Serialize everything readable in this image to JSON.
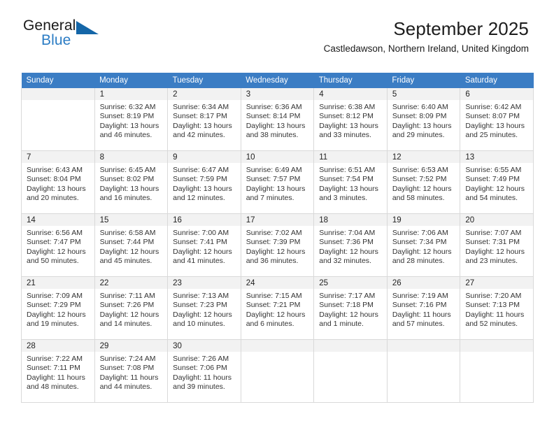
{
  "brand": {
    "name_part1": "General",
    "name_part2": "Blue",
    "triangle_color": "#1466a8",
    "blue_color": "#2b7cc4"
  },
  "header": {
    "title": "September 2025",
    "location": "Castledawson, Northern Ireland, United Kingdom"
  },
  "calendar": {
    "header_bg": "#3b7dc4",
    "daynum_bg": "#f2f2f2",
    "weekday_headers": [
      "Sunday",
      "Monday",
      "Tuesday",
      "Wednesday",
      "Thursday",
      "Friday",
      "Saturday"
    ],
    "weeks": [
      [
        {
          "day": "",
          "sunrise": "",
          "sunset": "",
          "daylight1": "",
          "daylight2": "",
          "empty": true
        },
        {
          "day": "1",
          "sunrise": "Sunrise: 6:32 AM",
          "sunset": "Sunset: 8:19 PM",
          "daylight1": "Daylight: 13 hours",
          "daylight2": "and 46 minutes."
        },
        {
          "day": "2",
          "sunrise": "Sunrise: 6:34 AM",
          "sunset": "Sunset: 8:17 PM",
          "daylight1": "Daylight: 13 hours",
          "daylight2": "and 42 minutes."
        },
        {
          "day": "3",
          "sunrise": "Sunrise: 6:36 AM",
          "sunset": "Sunset: 8:14 PM",
          "daylight1": "Daylight: 13 hours",
          "daylight2": "and 38 minutes."
        },
        {
          "day": "4",
          "sunrise": "Sunrise: 6:38 AM",
          "sunset": "Sunset: 8:12 PM",
          "daylight1": "Daylight: 13 hours",
          "daylight2": "and 33 minutes."
        },
        {
          "day": "5",
          "sunrise": "Sunrise: 6:40 AM",
          "sunset": "Sunset: 8:09 PM",
          "daylight1": "Daylight: 13 hours",
          "daylight2": "and 29 minutes."
        },
        {
          "day": "6",
          "sunrise": "Sunrise: 6:42 AM",
          "sunset": "Sunset: 8:07 PM",
          "daylight1": "Daylight: 13 hours",
          "daylight2": "and 25 minutes."
        }
      ],
      [
        {
          "day": "7",
          "sunrise": "Sunrise: 6:43 AM",
          "sunset": "Sunset: 8:04 PM",
          "daylight1": "Daylight: 13 hours",
          "daylight2": "and 20 minutes."
        },
        {
          "day": "8",
          "sunrise": "Sunrise: 6:45 AM",
          "sunset": "Sunset: 8:02 PM",
          "daylight1": "Daylight: 13 hours",
          "daylight2": "and 16 minutes."
        },
        {
          "day": "9",
          "sunrise": "Sunrise: 6:47 AM",
          "sunset": "Sunset: 7:59 PM",
          "daylight1": "Daylight: 13 hours",
          "daylight2": "and 12 minutes."
        },
        {
          "day": "10",
          "sunrise": "Sunrise: 6:49 AM",
          "sunset": "Sunset: 7:57 PM",
          "daylight1": "Daylight: 13 hours",
          "daylight2": "and 7 minutes."
        },
        {
          "day": "11",
          "sunrise": "Sunrise: 6:51 AM",
          "sunset": "Sunset: 7:54 PM",
          "daylight1": "Daylight: 13 hours",
          "daylight2": "and 3 minutes."
        },
        {
          "day": "12",
          "sunrise": "Sunrise: 6:53 AM",
          "sunset": "Sunset: 7:52 PM",
          "daylight1": "Daylight: 12 hours",
          "daylight2": "and 58 minutes."
        },
        {
          "day": "13",
          "sunrise": "Sunrise: 6:55 AM",
          "sunset": "Sunset: 7:49 PM",
          "daylight1": "Daylight: 12 hours",
          "daylight2": "and 54 minutes."
        }
      ],
      [
        {
          "day": "14",
          "sunrise": "Sunrise: 6:56 AM",
          "sunset": "Sunset: 7:47 PM",
          "daylight1": "Daylight: 12 hours",
          "daylight2": "and 50 minutes."
        },
        {
          "day": "15",
          "sunrise": "Sunrise: 6:58 AM",
          "sunset": "Sunset: 7:44 PM",
          "daylight1": "Daylight: 12 hours",
          "daylight2": "and 45 minutes."
        },
        {
          "day": "16",
          "sunrise": "Sunrise: 7:00 AM",
          "sunset": "Sunset: 7:41 PM",
          "daylight1": "Daylight: 12 hours",
          "daylight2": "and 41 minutes."
        },
        {
          "day": "17",
          "sunrise": "Sunrise: 7:02 AM",
          "sunset": "Sunset: 7:39 PM",
          "daylight1": "Daylight: 12 hours",
          "daylight2": "and 36 minutes."
        },
        {
          "day": "18",
          "sunrise": "Sunrise: 7:04 AM",
          "sunset": "Sunset: 7:36 PM",
          "daylight1": "Daylight: 12 hours",
          "daylight2": "and 32 minutes."
        },
        {
          "day": "19",
          "sunrise": "Sunrise: 7:06 AM",
          "sunset": "Sunset: 7:34 PM",
          "daylight1": "Daylight: 12 hours",
          "daylight2": "and 28 minutes."
        },
        {
          "day": "20",
          "sunrise": "Sunrise: 7:07 AM",
          "sunset": "Sunset: 7:31 PM",
          "daylight1": "Daylight: 12 hours",
          "daylight2": "and 23 minutes."
        }
      ],
      [
        {
          "day": "21",
          "sunrise": "Sunrise: 7:09 AM",
          "sunset": "Sunset: 7:29 PM",
          "daylight1": "Daylight: 12 hours",
          "daylight2": "and 19 minutes."
        },
        {
          "day": "22",
          "sunrise": "Sunrise: 7:11 AM",
          "sunset": "Sunset: 7:26 PM",
          "daylight1": "Daylight: 12 hours",
          "daylight2": "and 14 minutes."
        },
        {
          "day": "23",
          "sunrise": "Sunrise: 7:13 AM",
          "sunset": "Sunset: 7:23 PM",
          "daylight1": "Daylight: 12 hours",
          "daylight2": "and 10 minutes."
        },
        {
          "day": "24",
          "sunrise": "Sunrise: 7:15 AM",
          "sunset": "Sunset: 7:21 PM",
          "daylight1": "Daylight: 12 hours",
          "daylight2": "and 6 minutes."
        },
        {
          "day": "25",
          "sunrise": "Sunrise: 7:17 AM",
          "sunset": "Sunset: 7:18 PM",
          "daylight1": "Daylight: 12 hours",
          "daylight2": "and 1 minute."
        },
        {
          "day": "26",
          "sunrise": "Sunrise: 7:19 AM",
          "sunset": "Sunset: 7:16 PM",
          "daylight1": "Daylight: 11 hours",
          "daylight2": "and 57 minutes."
        },
        {
          "day": "27",
          "sunrise": "Sunrise: 7:20 AM",
          "sunset": "Sunset: 7:13 PM",
          "daylight1": "Daylight: 11 hours",
          "daylight2": "and 52 minutes."
        }
      ],
      [
        {
          "day": "28",
          "sunrise": "Sunrise: 7:22 AM",
          "sunset": "Sunset: 7:11 PM",
          "daylight1": "Daylight: 11 hours",
          "daylight2": "and 48 minutes."
        },
        {
          "day": "29",
          "sunrise": "Sunrise: 7:24 AM",
          "sunset": "Sunset: 7:08 PM",
          "daylight1": "Daylight: 11 hours",
          "daylight2": "and 44 minutes."
        },
        {
          "day": "30",
          "sunrise": "Sunrise: 7:26 AM",
          "sunset": "Sunset: 7:06 PM",
          "daylight1": "Daylight: 11 hours",
          "daylight2": "and 39 minutes."
        },
        {
          "day": "",
          "sunrise": "",
          "sunset": "",
          "daylight1": "",
          "daylight2": "",
          "empty": true
        },
        {
          "day": "",
          "sunrise": "",
          "sunset": "",
          "daylight1": "",
          "daylight2": "",
          "empty": true
        },
        {
          "day": "",
          "sunrise": "",
          "sunset": "",
          "daylight1": "",
          "daylight2": "",
          "empty": true
        },
        {
          "day": "",
          "sunrise": "",
          "sunset": "",
          "daylight1": "",
          "daylight2": "",
          "empty": true
        }
      ]
    ]
  }
}
